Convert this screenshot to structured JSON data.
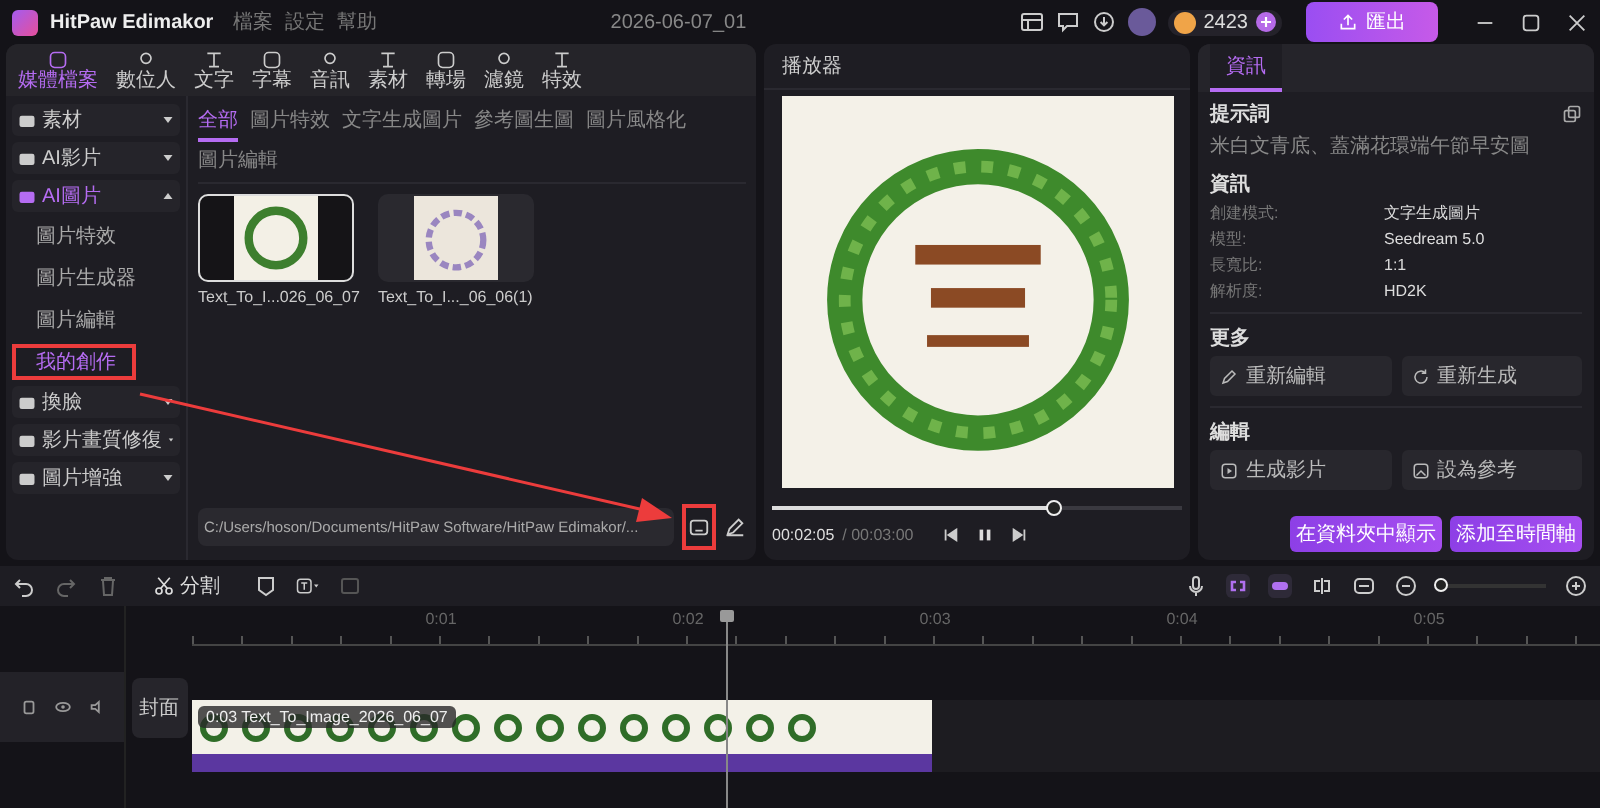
{
  "app": {
    "title": "HitPaw Edimakor",
    "menus": [
      "檔案",
      "設定",
      "幫助"
    ],
    "project": "2026-06-07_01",
    "credits": "2423",
    "export": "匯出"
  },
  "toolbar": [
    {
      "label": "媒體檔案",
      "selected": true
    },
    {
      "label": "數位人",
      "selected": false
    },
    {
      "label": "文字",
      "selected": false
    },
    {
      "label": "字幕",
      "selected": false
    },
    {
      "label": "音訊",
      "selected": false
    },
    {
      "label": "素材",
      "selected": false
    },
    {
      "label": "轉場",
      "selected": false
    },
    {
      "label": "濾鏡",
      "selected": false
    },
    {
      "label": "特效",
      "selected": false
    }
  ],
  "sidebar": [
    {
      "label": "素材",
      "expanded": false
    },
    {
      "label": "AI影片",
      "expanded": false
    },
    {
      "label": "AI圖片",
      "expanded": true,
      "children": [
        {
          "label": "圖片特效",
          "selected": false
        },
        {
          "label": "圖片生成器",
          "selected": false
        },
        {
          "label": "圖片編輯",
          "selected": false
        },
        {
          "label": "我的創作",
          "selected": true
        }
      ]
    },
    {
      "label": "換臉",
      "expanded": false
    },
    {
      "label": "影片畫質修復",
      "expanded": false
    },
    {
      "label": "圖片增強",
      "expanded": false
    }
  ],
  "subtabs": [
    {
      "label": "全部",
      "selected": true
    },
    {
      "label": "圖片特效",
      "selected": false
    },
    {
      "label": "文字生成圖片",
      "selected": false
    },
    {
      "label": "參考圖生圖",
      "selected": false
    },
    {
      "label": "圖片風格化",
      "selected": false
    },
    {
      "label": "圖片編輯",
      "selected": false
    }
  ],
  "media": [
    {
      "name": "Text_To_I...026_06_07",
      "selected": true
    },
    {
      "name": "Text_To_I..._06_06(1)",
      "selected": false
    }
  ],
  "path": "C:/Users/hoson/Documents/HitPaw Software/HitPaw Edimakor/...",
  "player": {
    "title": "播放器",
    "current": "00:02:05",
    "total": "/ 00:03:00",
    "level": 0.69
  },
  "info": {
    "tab": "資訊",
    "prompt_heading": "提示詞",
    "prompt": "米白文青底、蓋滿花環端午節早安圖",
    "details_heading": "資訊",
    "details": [
      {
        "label": "創建模式:",
        "value": "文字生成圖片"
      },
      {
        "label": "模型:",
        "value": "Seedream 5.0"
      },
      {
        "label": "長寬比:",
        "value": "1:1"
      },
      {
        "label": "解析度:",
        "value": "HD2K"
      }
    ],
    "more_heading": "更多",
    "more_buttons": [
      "重新編輯",
      "重新生成"
    ],
    "edit_heading": "編輯",
    "edit_buttons": [
      "生成影片",
      "設為參考"
    ],
    "footer_buttons": [
      "在資料夾中顯示",
      "添加至時間軸"
    ]
  },
  "timeline": {
    "split": "分割",
    "ticks": [
      "0:01",
      "0:02",
      "0:03",
      "0:04",
      "0:05"
    ],
    "track_label": "封面",
    "clip": "0:03 Text_To_Image_2026_06_07",
    "zoom": {
      "level": 0.03
    }
  }
}
